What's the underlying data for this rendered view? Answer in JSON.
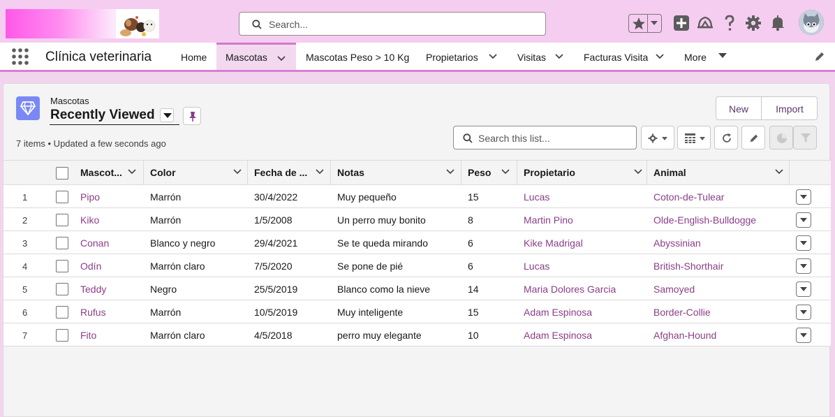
{
  "header": {
    "search_placeholder": "Search...",
    "icons": [
      "star-icon",
      "chevron-down-icon",
      "add-icon",
      "trailhead-icon",
      "help-icon",
      "gear-icon",
      "bell-icon",
      "avatar"
    ]
  },
  "nav": {
    "app_name": "Clínica veterinaria",
    "items": [
      {
        "label": "Home",
        "active": false,
        "dropdown": false
      },
      {
        "label": "Mascotas",
        "active": true,
        "dropdown": true
      },
      {
        "label": "Mascotas Peso > 10 Kg",
        "active": false,
        "dropdown": false
      },
      {
        "label": "Propietarios",
        "active": false,
        "dropdown": true
      },
      {
        "label": "Visitas",
        "active": false,
        "dropdown": true
      },
      {
        "label": "Facturas Visita",
        "active": false,
        "dropdown": true
      },
      {
        "label": "More",
        "active": false,
        "dropdown": true
      }
    ]
  },
  "list": {
    "object_label": "Mascotas",
    "view_name": "Recently Viewed",
    "status": "7 items • Updated a few seconds ago",
    "new_label": "New",
    "import_label": "Import",
    "search_placeholder": "Search this list..."
  },
  "table": {
    "columns": [
      "Mascot...",
      "Color",
      "Fecha de ...",
      "Notas",
      "Peso",
      "Propietario",
      "Animal"
    ],
    "rows": [
      {
        "n": "1",
        "mascota": "Pipo",
        "color": "Marrón",
        "fecha": "30/4/2022",
        "notas": "Muy pequeño",
        "peso": "15",
        "propietario": "Lucas",
        "animal": "Coton-de-Tulear"
      },
      {
        "n": "2",
        "mascota": "Kiko",
        "color": "Marrón",
        "fecha": "1/5/2008",
        "notas": "Un perro muy bonito",
        "peso": "8",
        "propietario": "Martin Pino",
        "animal": "Olde-English-Bulldogge"
      },
      {
        "n": "3",
        "mascota": "Conan",
        "color": "Blanco y negro",
        "fecha": "29/4/2021",
        "notas": "Se te queda mirando",
        "peso": "6",
        "propietario": "Kike Madrigal",
        "animal": "Abyssinian"
      },
      {
        "n": "4",
        "mascota": "Odín",
        "color": "Marrón claro",
        "fecha": "7/5/2020",
        "notas": "Se pone de pié",
        "peso": "6",
        "propietario": "Lucas",
        "animal": "British-Shorthair"
      },
      {
        "n": "5",
        "mascota": "Teddy",
        "color": "Negro",
        "fecha": "25/5/2019",
        "notas": "Blanco como la nieve",
        "peso": "14",
        "propietario": "Maria Dolores Garcia",
        "animal": "Samoyed"
      },
      {
        "n": "6",
        "mascota": "Rufus",
        "color": "Marrón",
        "fecha": "10/5/2019",
        "notas": "Muy inteligente",
        "peso": "15",
        "propietario": "Adam Espinosa",
        "animal": "Border-Collie"
      },
      {
        "n": "7",
        "mascota": "Fito",
        "color": "Marrón claro",
        "fecha": "4/5/2018",
        "notas": "perro muy elegante",
        "peso": "10",
        "propietario": "Adam Espinosa",
        "animal": "Afghan-Hound"
      }
    ]
  }
}
